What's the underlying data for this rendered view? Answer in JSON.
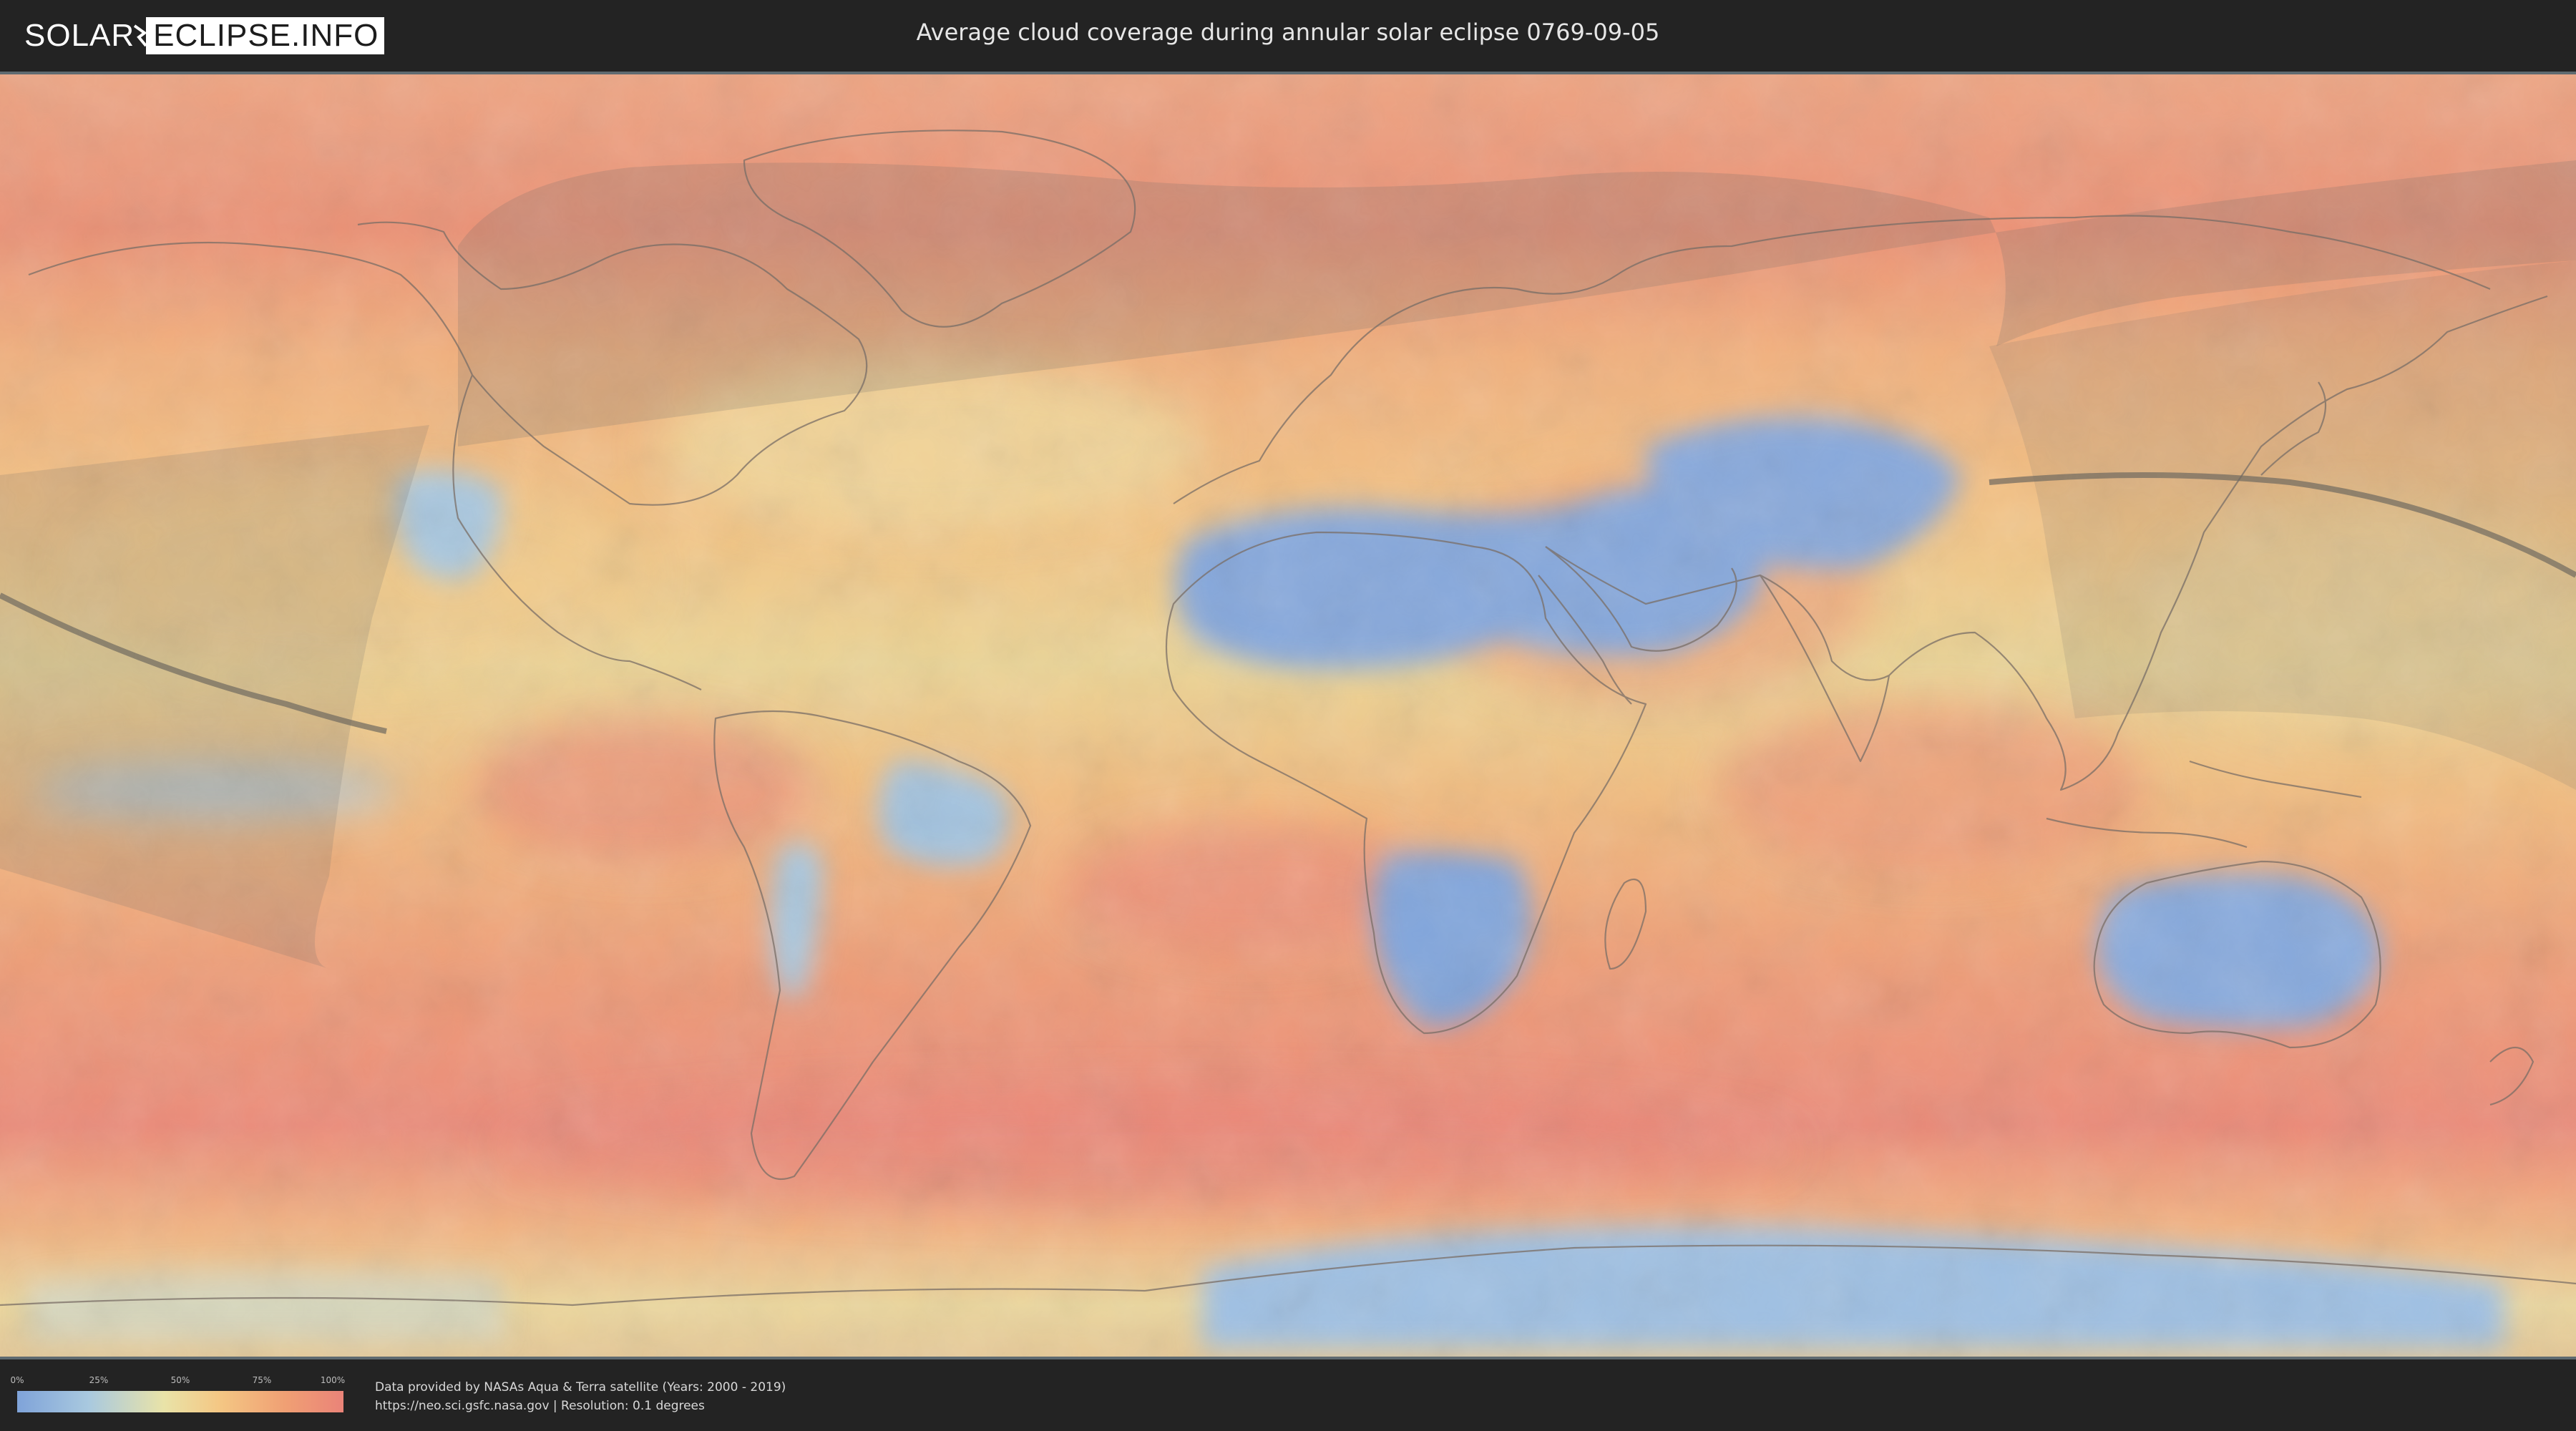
{
  "header": {
    "logo_left": "SOLAR",
    "logo_right": "ECLIPSE.INFO",
    "title": "Average cloud coverage during annular solar eclipse 0769-09-05"
  },
  "legend": {
    "ticks": [
      "0%",
      "25%",
      "50%",
      "75%",
      "100%"
    ],
    "colors": [
      "#7fa3d9",
      "#a9c9df",
      "#e9e3a8",
      "#f4c784",
      "#ea8378"
    ]
  },
  "credit": {
    "line1": "Data provided by NASAs Aqua & Terra satellite (Years: 2000 - 2019)",
    "line2": "https://neo.sci.gsfc.nasa.gov | Resolution: 0.1 degrees"
  },
  "map": {
    "projection": "equirectangular",
    "layer": "average cloud coverage",
    "overlays": [
      "eclipse visibility zone",
      "central path of annularity"
    ],
    "palette": {
      "clear": "#7ea3dc",
      "low": "#a8c8e0",
      "mid": "#ece3a6",
      "high": "#f2b27e",
      "full": "#ec8679",
      "land_outline": "#6b6b6b",
      "shade": "#6a6a6a"
    }
  }
}
